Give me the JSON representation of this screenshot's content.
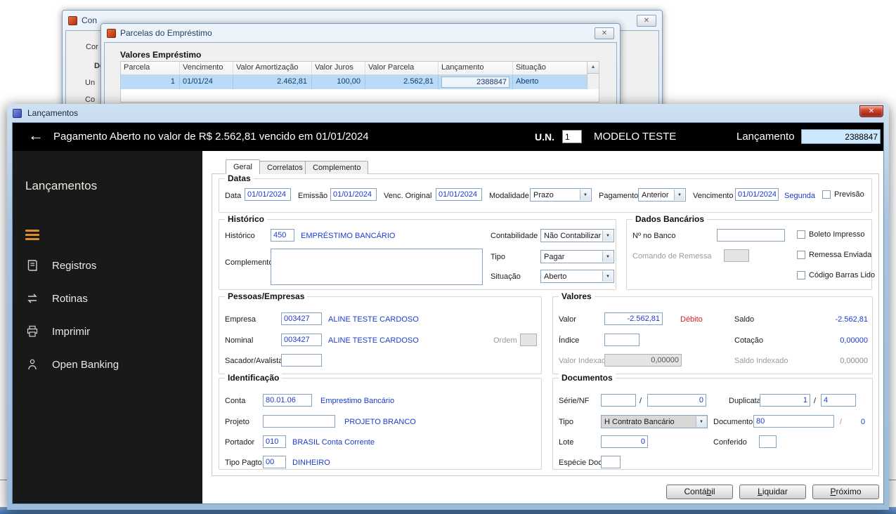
{
  "colors": {
    "field_text_blue": "#1c3bcd",
    "debit_red": "#d02020",
    "selected_row_bg": "#b9dbf8",
    "sidebar_bg": "#191919",
    "sidebar_accent_orange": "#d98e2b",
    "header_bg": "#000000",
    "bottom_strip_blue": "#4d7fb8"
  },
  "icons": {
    "back": "←",
    "close": "✕",
    "combo_arrow": "▼",
    "scroll_up": "▲"
  },
  "background_windows": {
    "win_a": {
      "title": "Con",
      "frag_tab": "Cor",
      "frag_1": "De",
      "frag_2": "Un",
      "frag_3": "Co"
    },
    "parcelas": {
      "title": "Parcelas do Empréstimo",
      "group_title": "Valores Empréstimo",
      "columns": [
        "Parcela",
        "Vencimento",
        "Valor Amortização",
        "Valor Juros",
        "Valor Parcela",
        "Lançamento",
        "Situação"
      ],
      "row": {
        "parcela": "1",
        "vencimento": "01/01/24",
        "amortizacao": "2.462,81",
        "juros": "100,00",
        "parcela_valor": "2.562,81",
        "lancamento": "2388847",
        "situacao": "Aberto"
      }
    }
  },
  "app": {
    "title": "Lançamentos",
    "header": {
      "title": "Pagamento Aberto no valor de R$ 2.562,81 vencido em 01/01/2024",
      "un_label": "U.N.",
      "un_value": "1",
      "company": "MODELO TESTE",
      "lanc_label": "Lançamento",
      "lanc_value": "2388847"
    },
    "sidebar": {
      "title": "Lançamentos",
      "items": [
        "Registros",
        "Rotinas",
        "Imprimir",
        "Open Banking"
      ]
    },
    "tabs": [
      "Geral",
      "Correlatos",
      "Complemento"
    ],
    "datas": {
      "legend": "Datas",
      "data_label": "Data",
      "data_value": "01/01/2024",
      "emissao_label": "Emissão",
      "emissao_value": "01/01/2024",
      "venc_original_label": "Venc. Original",
      "venc_original_value": "01/01/2024",
      "modalidade_label": "Modalidade",
      "modalidade_value": "Prazo",
      "pagamento_label": "Pagamento",
      "pagamento_value": "Anterior",
      "vencimento_label": "Vencimento",
      "vencimento_value": "01/01/2024",
      "weekday": "Segunda",
      "previsao_label": "Previsão"
    },
    "historico": {
      "legend": "Histórico",
      "historico_label": "Histórico",
      "historico_code": "450",
      "historico_desc": "EMPRÉSTIMO BANCÁRIO",
      "complemento_label": "Complemento",
      "complemento_value": "",
      "contabilidade_label": "Contabilidade",
      "contabilidade_value": "Não Contabilizar",
      "tipo_label": "Tipo",
      "tipo_value": "Pagar",
      "situacao_label": "Situação",
      "situacao_value": "Aberto"
    },
    "bancarios": {
      "legend": "Dados Bancários",
      "num_banco_label": "Nº no Banco",
      "num_banco_value": "",
      "boleto_label": "Boleto Impresso",
      "comando_label": "Comando de Remessa",
      "comando_value": "",
      "remessa_label": "Remessa Enviada",
      "barras_label": "Código Barras Lido"
    },
    "pessoas": {
      "legend": "Pessoas/Empresas",
      "empresa_label": "Empresa",
      "empresa_code": "003427",
      "empresa_desc": "ALINE TESTE CARDOSO",
      "nominal_label": "Nominal",
      "nominal_code": "003427",
      "nominal_desc": "ALINE TESTE CARDOSO",
      "ordem_label": "Ordem",
      "ordem_value": "",
      "sacador_label": "Sacador/Avalista",
      "sacador_value": ""
    },
    "valores": {
      "legend": "Valores",
      "valor_label": "Valor",
      "valor_value": "-2.562,81",
      "debito_tag": "Débito",
      "saldo_label": "Saldo",
      "saldo_value": "-2.562,81",
      "indice_label": "Índice",
      "indice_value": "",
      "cotacao_label": "Cotação",
      "cotacao_value": "0,00000",
      "valor_indexado_label": "Valor Indexado",
      "valor_indexado_value": "0,00000",
      "saldo_indexado_label": "Saldo Indexado",
      "saldo_indexado_value": "0,00000"
    },
    "identificacao": {
      "legend": "Identificação",
      "conta_label": "Conta",
      "conta_code": "80.01.06",
      "conta_desc": "Emprestimo Bancário",
      "projeto_label": "Projeto",
      "projeto_code": "",
      "projeto_desc": "PROJETO BRANCO",
      "portador_label": "Portador",
      "portador_code": "010",
      "portador_desc": "BRASIL Conta Corrente",
      "tipo_pagto_label": "Tipo Pagto.",
      "tipo_pagto_code": "00",
      "tipo_pagto_desc": "DINHEIRO"
    },
    "documentos": {
      "legend": "Documentos",
      "serie_label": "Série/NF",
      "serie_value": "",
      "serie_sep": "/",
      "serie_num": "0",
      "duplicata_label": "Duplicata",
      "duplicata_value": "1",
      "duplicata_sep": "/",
      "duplicata_total": "4",
      "tipo_label": "Tipo",
      "tipo_value": "H Contrato Bancário",
      "documento_label": "Documento",
      "documento_value": "80",
      "documento_sep": "/",
      "documento_extra": "0",
      "lote_label": "Lote",
      "lote_value": "0",
      "conferido_label": "Conferido",
      "conferido_value": "",
      "especie_label": "Espécie Doc.",
      "especie_value": ""
    },
    "footer_buttons": {
      "contabil": {
        "pre": "Contá",
        "key": "b",
        "post": "il"
      },
      "liquidar": {
        "pre": "",
        "key": "L",
        "post": "iquidar"
      },
      "proximo": {
        "pre": "",
        "key": "P",
        "post": "róximo"
      }
    }
  }
}
